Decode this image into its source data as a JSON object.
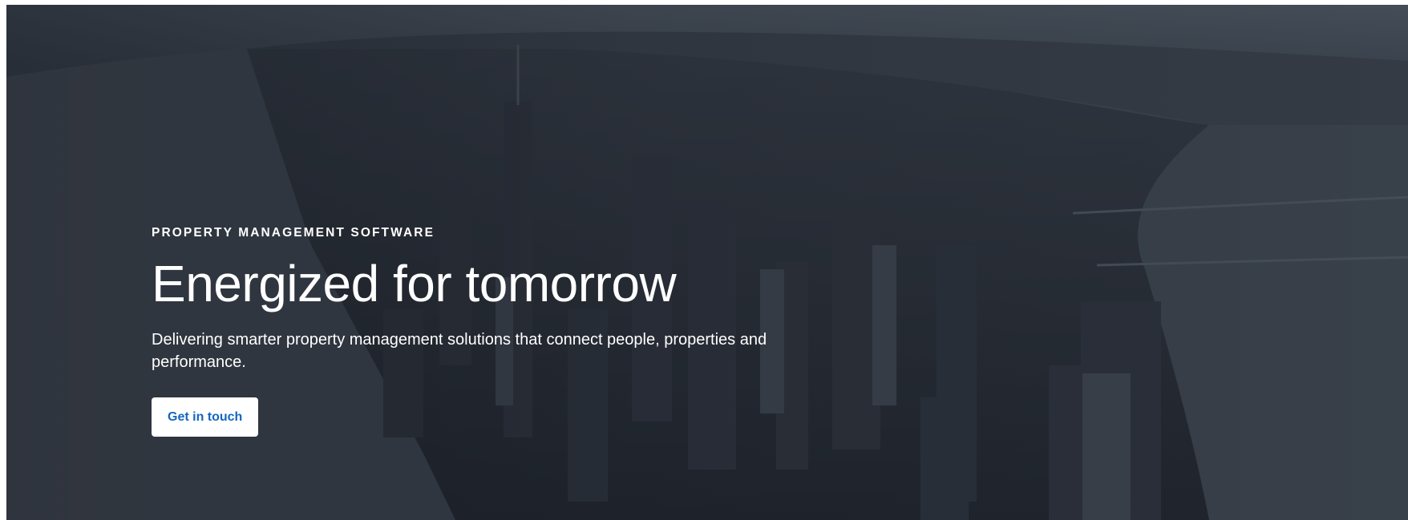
{
  "hero": {
    "eyebrow": "PROPERTY MANAGEMENT SOFTWARE",
    "headline": "Energized for tomorrow",
    "subtext": "Delivering smarter property management solutions that connect people, properties and performance.",
    "cta_label": "Get in touch",
    "background_image": "aerial-city-skyline-photo"
  },
  "colors": {
    "overlay": "#12161e",
    "text": "#ffffff",
    "button_bg": "#ffffff",
    "button_text": "#1565c0"
  }
}
